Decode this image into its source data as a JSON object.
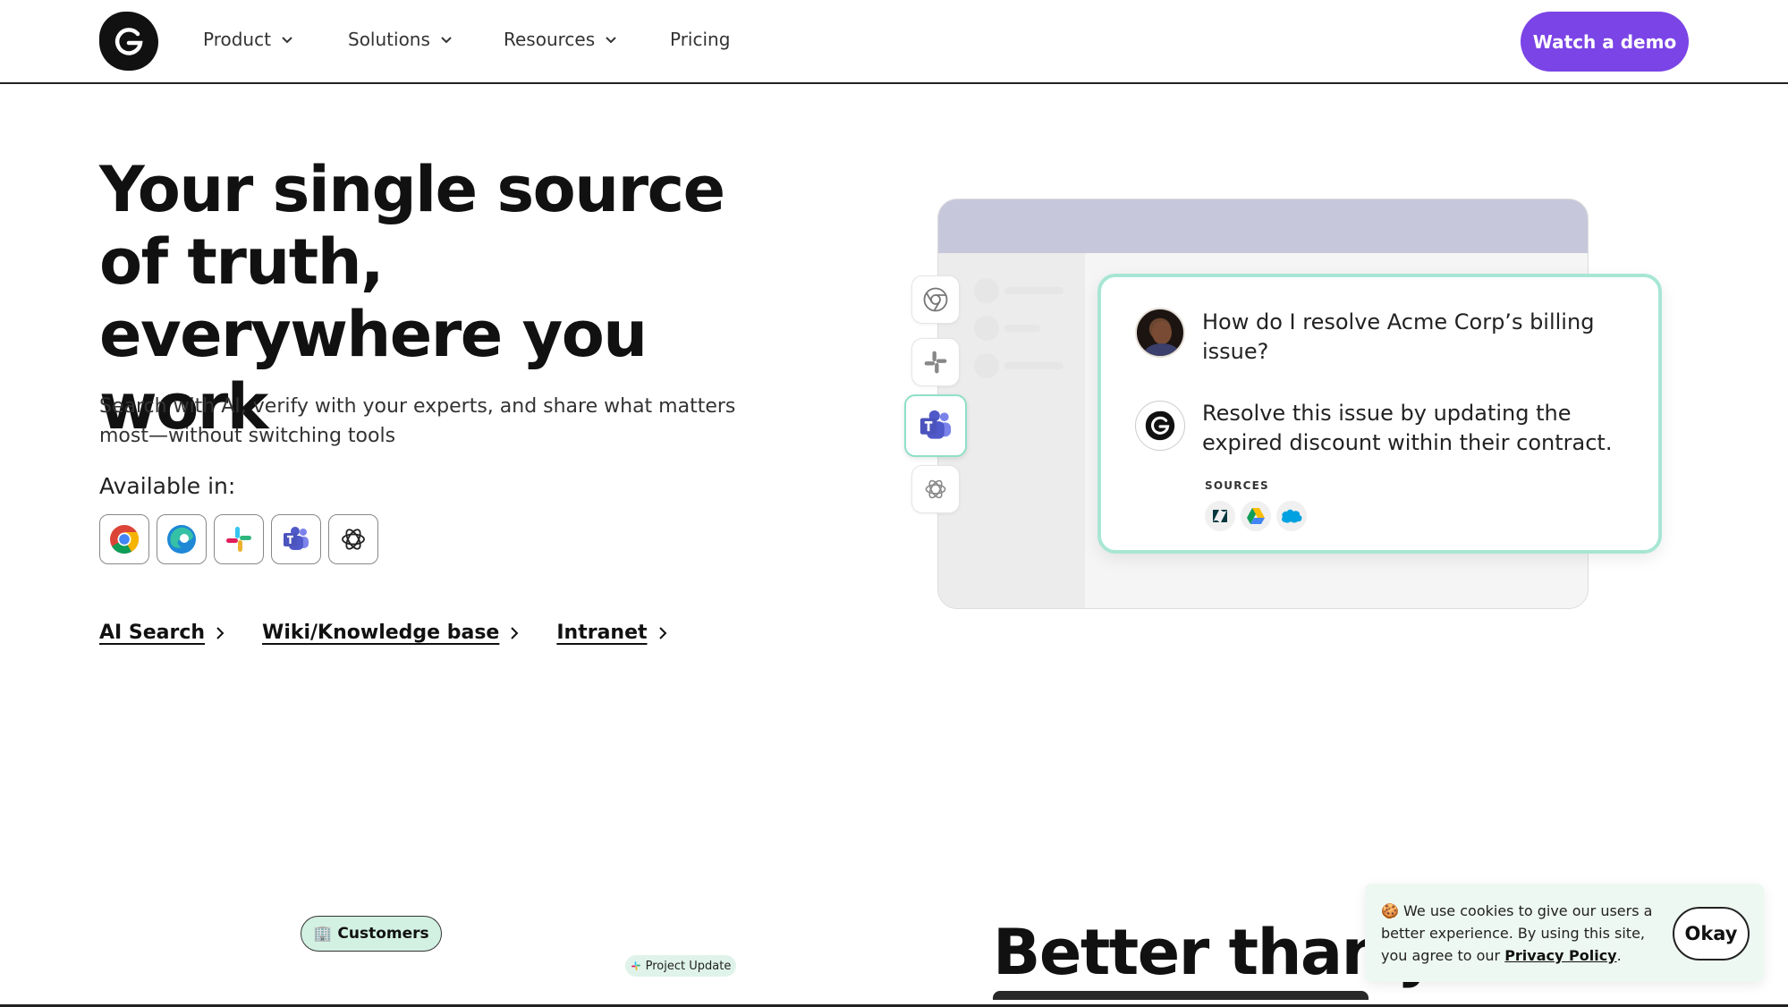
{
  "nav": {
    "items": [
      {
        "label": "Product"
      },
      {
        "label": "Solutions"
      },
      {
        "label": "Resources"
      },
      {
        "label": "Pricing"
      }
    ],
    "cta_label": "Watch a demo",
    "accent": "#7b44e6"
  },
  "hero": {
    "title": "Your single source of truth, everywhere you work",
    "subtitle": "Search with AI, verify with your experts, and share what matters most—without switching tools",
    "available_label": "Available in:",
    "available_icons": [
      "chrome-icon",
      "edge-icon",
      "slack-icon",
      "teams-icon",
      "chatgpt-icon"
    ],
    "links": [
      {
        "label": "AI Search"
      },
      {
        "label": "Wiki/Knowledge base"
      },
      {
        "label": "Intranet"
      }
    ]
  },
  "illustration": {
    "side_apps": [
      "chrome-icon",
      "slack-icon",
      "teams-icon",
      "chatgpt-icon"
    ],
    "active_app": "teams-icon",
    "question": "How do I resolve Acme Corp’s billing issue?",
    "answer": "Resolve this issue by updating the expired discount within their contract.",
    "sources_label": "SOURCES",
    "source_icons": [
      "zendesk-icon",
      "google-drive-icon",
      "salesforce-icon"
    ],
    "card_border": "#a8e6d4"
  },
  "bottom": {
    "customers_pill": "🏢 Customers",
    "project_pill": "Project Update",
    "heading_visible": "Better than ju"
  },
  "cookie": {
    "text_before": "🍪 We use cookies to give our users a better experience.  By using this site, you agree to our ",
    "link": "Privacy Policy",
    "text_after": ".",
    "button": "Okay"
  }
}
